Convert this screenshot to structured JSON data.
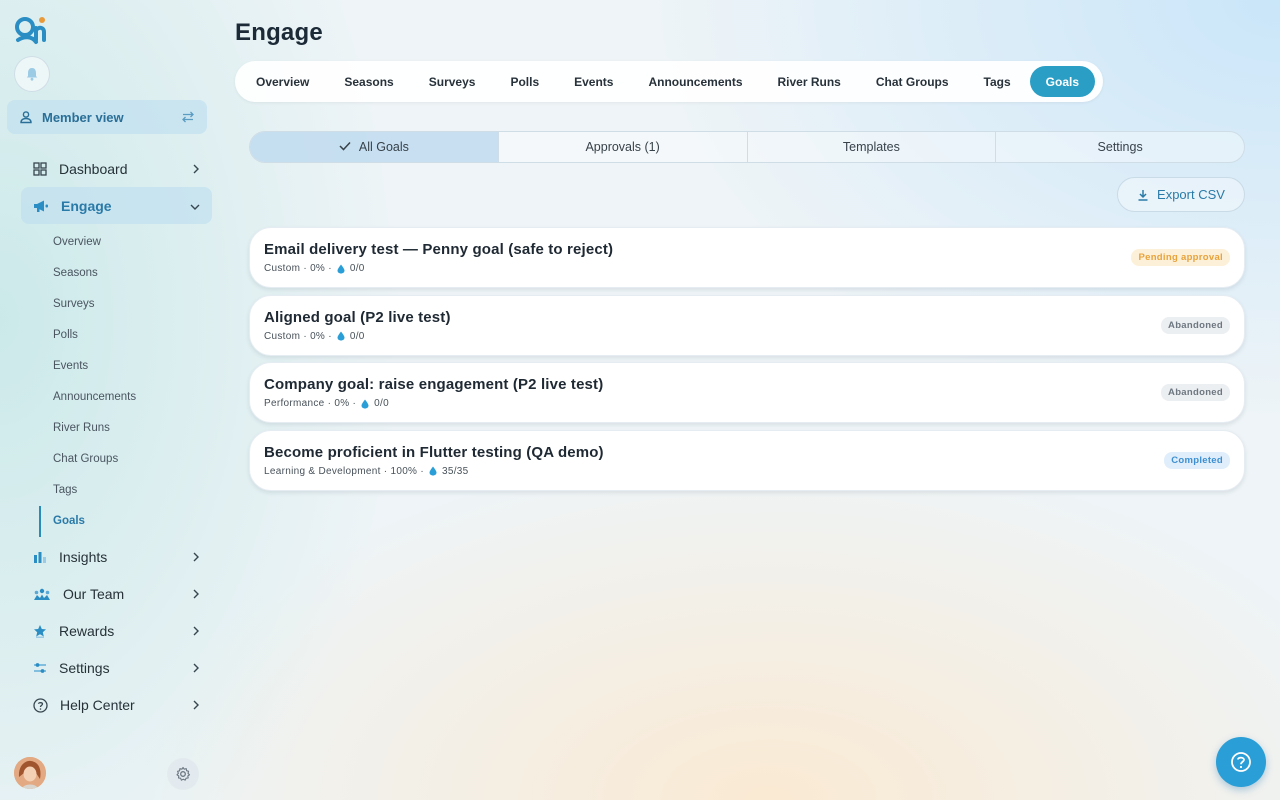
{
  "sidebar": {
    "member_view": "Member view",
    "nav": [
      {
        "label": "Dashboard",
        "icon": "dashboard-icon"
      },
      {
        "label": "Engage",
        "icon": "megaphone-icon",
        "active": true
      },
      {
        "label": "Insights",
        "icon": "bar-chart-icon"
      },
      {
        "label": "Our Team",
        "icon": "team-icon"
      },
      {
        "label": "Rewards",
        "icon": "star-icon"
      },
      {
        "label": "Settings",
        "icon": "sliders-icon"
      },
      {
        "label": "Help Center",
        "icon": "help-icon"
      }
    ],
    "engage_sub": [
      "Overview",
      "Seasons",
      "Surveys",
      "Polls",
      "Events",
      "Announcements",
      "River Runs",
      "Chat Groups",
      "Tags",
      "Goals"
    ],
    "engage_sub_active": "Goals"
  },
  "main": {
    "title": "Engage",
    "tabs": [
      "Overview",
      "Seasons",
      "Surveys",
      "Polls",
      "Events",
      "Announcements",
      "River Runs",
      "Chat Groups",
      "Tags",
      "Goals"
    ],
    "active_tab": "Goals",
    "segments": [
      "All Goals",
      "Approvals (1)",
      "Templates",
      "Settings"
    ],
    "active_segment": "All Goals",
    "export_label": "Export CSV",
    "goals": [
      {
        "title": "Email delivery test — Penny goal (safe to reject)",
        "category": "Custom",
        "percent": "0%",
        "progress": "0/0",
        "status": "Pending approval",
        "status_kind": "pending"
      },
      {
        "title": "Aligned goal (P2 live test)",
        "category": "Custom",
        "percent": "0%",
        "progress": "0/0",
        "status": "Abandoned",
        "status_kind": "abandoned"
      },
      {
        "title": "Company goal: raise engagement (P2 live test)",
        "category": "Performance",
        "percent": "0%",
        "progress": "0/0",
        "status": "Abandoned",
        "status_kind": "abandoned"
      },
      {
        "title": "Become proficient in Flutter testing (QA demo)",
        "category": "Learning & Development",
        "percent": "100%",
        "progress": "35/35",
        "status": "Completed",
        "status_kind": "completed"
      }
    ]
  },
  "colors": {
    "accent": "#2a9ec4",
    "brand": "#2a7aa8",
    "pending": "#e8a23a",
    "completed": "#3d8fd1"
  }
}
